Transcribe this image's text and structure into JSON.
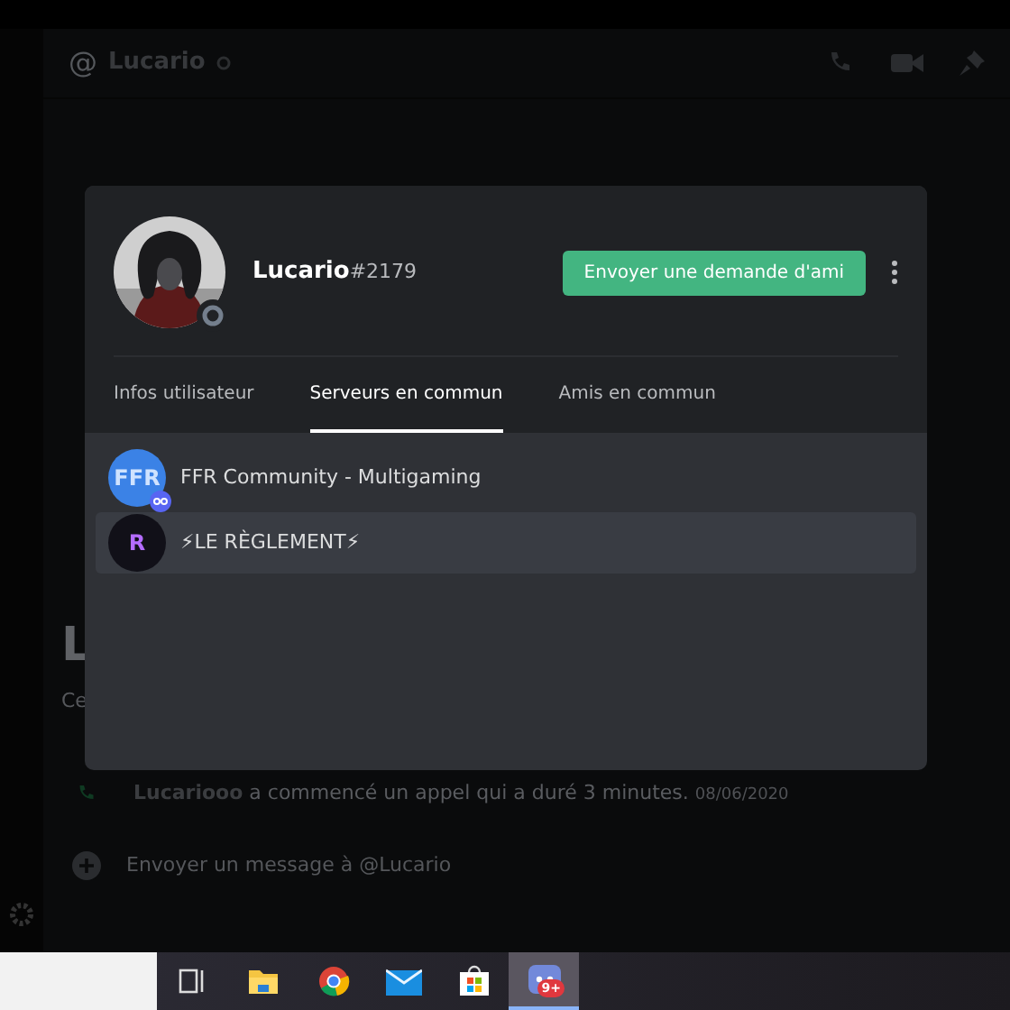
{
  "channel_header": {
    "symbol": "@",
    "name": "Lucario"
  },
  "background": {
    "heading": "L",
    "subtitle": "Ce"
  },
  "call_message": {
    "author": "Lucariooo",
    "text": "a commencé un appel qui a duré 3 minutes.",
    "date": "08/06/2020"
  },
  "message_input": {
    "placeholder": "Envoyer un message à @Lucario"
  },
  "profile": {
    "username": "Lucario",
    "discriminator": "#2179",
    "add_friend_button": "Envoyer une demande d'ami",
    "tabs": [
      {
        "label": "Infos utilisateur",
        "selected": false
      },
      {
        "label": "Serveurs en commun",
        "selected": true
      },
      {
        "label": "Amis en commun",
        "selected": false
      }
    ],
    "servers": [
      {
        "name": "FFR Community - Multigaming",
        "icon_text": "FFR",
        "color": "#3b82e6",
        "partnered": true,
        "selected": false
      },
      {
        "name": "⚡LE RÈGLEMENT⚡",
        "icon_text": "R",
        "color": "#111018",
        "partnered": false,
        "selected": true
      }
    ]
  },
  "taskbar": {
    "apps": [
      {
        "kind": "taskview",
        "active": false
      },
      {
        "kind": "files",
        "active": false
      },
      {
        "kind": "browser",
        "active": false
      },
      {
        "kind": "mail",
        "active": false
      },
      {
        "kind": "store",
        "active": false
      },
      {
        "kind": "chat",
        "active": true,
        "badge": "9+"
      }
    ]
  }
}
